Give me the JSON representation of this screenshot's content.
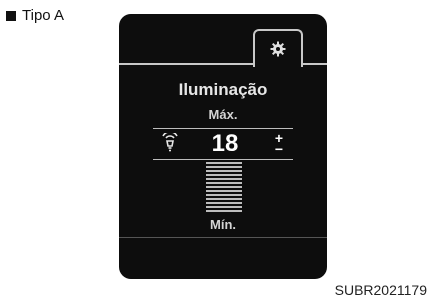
{
  "variant_label": "Tipo A",
  "caption": "SUBR2021179",
  "screen": {
    "settings_tab_icon": "gear-icon",
    "title": "Iluminação",
    "max_label": "Máx.",
    "min_label": "Mín.",
    "value": "18",
    "increase_symbol": "+",
    "decrease_symbol": "−",
    "brightness_icon": "bulb-icon"
  }
}
